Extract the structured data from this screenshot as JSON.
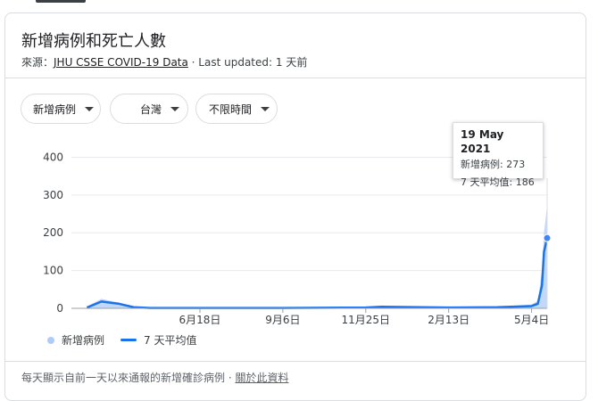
{
  "card": {
    "title": "新增病例和死亡人數",
    "source_prefix": "來源：",
    "source_link": "JHU CSSE COVID-19 Data",
    "last_updated": " · Last updated: 1 天前"
  },
  "filters": {
    "metric": "新增病例",
    "region": "台灣",
    "time_range": "不限時間"
  },
  "tooltip": {
    "date": "19 May 2021",
    "new_cases": "新增病例: 273",
    "avg": "7 天平均值: 186"
  },
  "legend": {
    "bars_label": "新增病例",
    "line_label": "7 天平均值"
  },
  "footer": {
    "text": "每天顯示自前一天以來通報的新增確診病例 · ",
    "link": "關於此資料"
  },
  "colors": {
    "line": "#1a73e8",
    "area": "#aecbfa",
    "highlight": "#4285f4"
  },
  "chart_data": {
    "type": "area",
    "ylim": [
      0,
      420
    ],
    "yticks": [
      0,
      100,
      200,
      300,
      400
    ],
    "ytick_labels": [
      "0",
      "100",
      "200",
      "300",
      "400"
    ],
    "xtick_labels": [
      "6月18日",
      "9月6日",
      "11月25日",
      "2月13日",
      "5月4日"
    ],
    "x_dates": [
      "2020-03-01",
      "2020-03-15",
      "2020-04-01",
      "2020-04-15",
      "2020-05-01",
      "2020-06-18",
      "2020-09-06",
      "2020-11-25",
      "2020-12-10",
      "2021-02-13",
      "2021-04-01",
      "2021-05-04",
      "2021-05-10",
      "2021-05-14",
      "2021-05-16",
      "2021-05-19"
    ],
    "series": [
      {
        "name": "新增病例",
        "values": [
          5,
          25,
          15,
          3,
          1,
          2,
          1,
          3,
          5,
          2,
          4,
          10,
          20,
          100,
          200,
          273
        ]
      },
      {
        "name": "7 天平均值",
        "values": [
          2,
          18,
          12,
          3,
          1,
          1,
          1,
          2,
          4,
          2,
          3,
          6,
          12,
          60,
          150,
          186
        ]
      }
    ],
    "highlight": {
      "date": "2021-05-19",
      "new_cases": 273,
      "avg": 186
    }
  }
}
